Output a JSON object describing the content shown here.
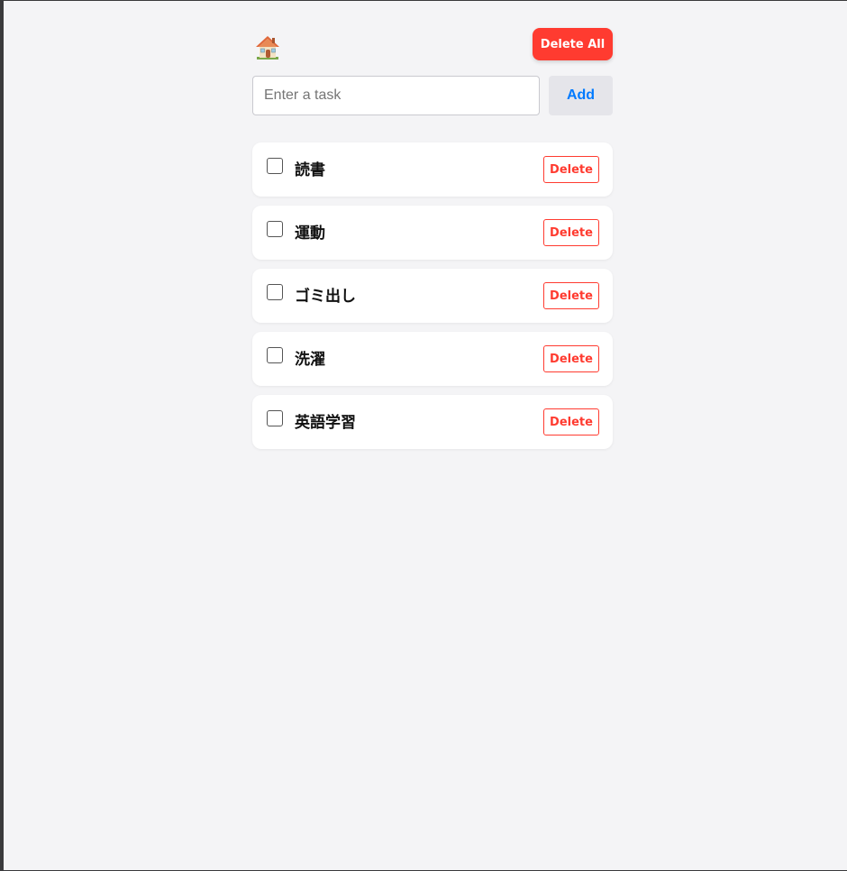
{
  "header": {
    "home_icon": "house-icon",
    "delete_all_label": "Delete All"
  },
  "input": {
    "placeholder": "Enter a task",
    "value": "",
    "add_label": "Add"
  },
  "tasks": [
    {
      "label": "読書",
      "checked": false,
      "delete_label": "Delete"
    },
    {
      "label": "運動",
      "checked": false,
      "delete_label": "Delete"
    },
    {
      "label": "ゴミ出し",
      "checked": false,
      "delete_label": "Delete"
    },
    {
      "label": "洗濯",
      "checked": false,
      "delete_label": "Delete"
    },
    {
      "label": "英語学習",
      "checked": false,
      "delete_label": "Delete"
    }
  ],
  "colors": {
    "danger": "#ff3b30",
    "accent": "#007aff",
    "background": "#f4f4f6",
    "card": "#ffffff"
  }
}
